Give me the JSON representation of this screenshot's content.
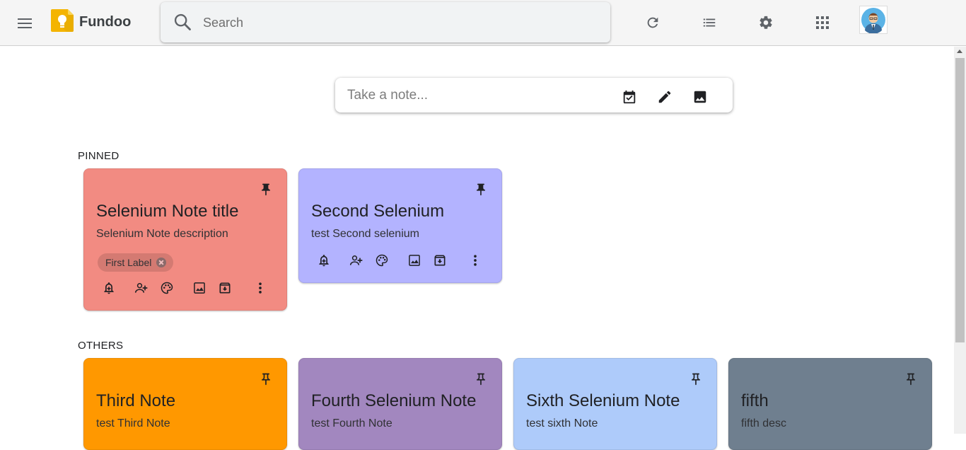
{
  "app": {
    "title": "Fundoo"
  },
  "search": {
    "placeholder": "Search",
    "value": ""
  },
  "take_note": {
    "placeholder": "Take a note..."
  },
  "sections": {
    "pinned": "PINNED",
    "others": "OTHERS"
  },
  "pinned_notes": [
    {
      "title": "Selenium Note title",
      "description": "Selenium Note description",
      "label": "First Label",
      "color": "#f28b82"
    },
    {
      "title": "Second Selenium",
      "description": "test Second selenium",
      "color": "#b3b3ff"
    }
  ],
  "other_notes": [
    {
      "title": "Third Note",
      "description": "test Third Note",
      "color": "#ff9800"
    },
    {
      "title": "Fourth Selenium Note",
      "description": "test Fourth Note",
      "color": "#a287bf"
    },
    {
      "title": "Sixth Selenium Note",
      "description": "test sixth Note",
      "color": "#aecbfa"
    },
    {
      "title": "fifth",
      "description": "fifth desc",
      "color": "#6f7f8f"
    }
  ],
  "icons": {
    "menu": "hamburger-menu-icon",
    "logo": "lightbulb-logo-icon",
    "search": "search-icon",
    "refresh": "refresh-icon",
    "list_view": "list-view-icon",
    "settings": "gear-icon",
    "apps": "apps-grid-icon",
    "new_list": "checkbox-calendar-icon",
    "drawing": "pencil-icon",
    "image": "image-icon",
    "reminder": "bell-plus-icon",
    "collaborator": "person-add-icon",
    "color": "palette-icon",
    "archive": "archive-icon",
    "more": "more-vertical-icon",
    "pin_filled": "pin-filled-icon",
    "pin_outline": "pin-outline-icon"
  }
}
